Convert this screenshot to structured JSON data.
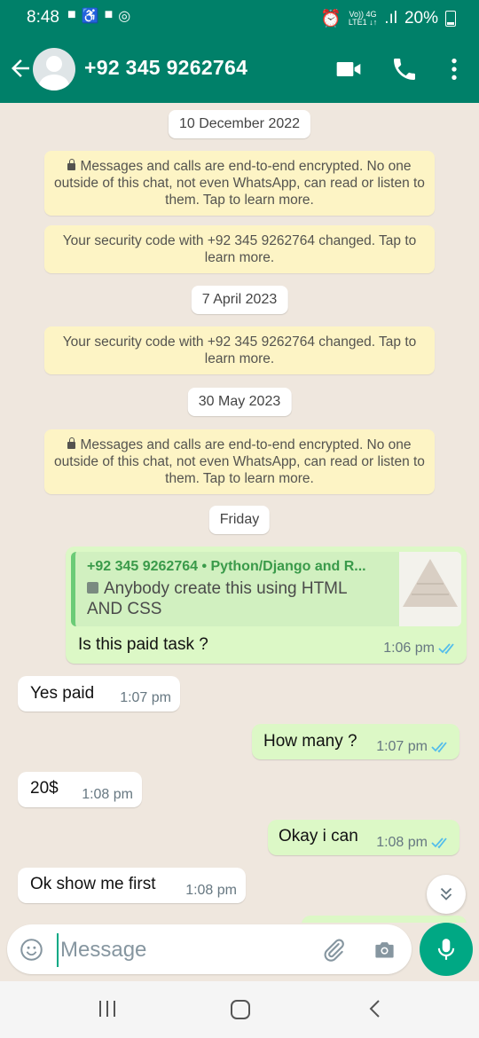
{
  "status_bar": {
    "time": "8:48",
    "network_top": "Vo)) 4G",
    "network_bottom": "LTE1 ↓↑",
    "battery": "20%"
  },
  "header": {
    "contact": "+92 345 9262764",
    "icons": [
      "back-arrow-icon",
      "avatar",
      "video-call-icon",
      "voice-call-icon",
      "more-options-icon"
    ]
  },
  "chat": {
    "date_1": "10 December 2022",
    "encryption_notice_1": "Messages and calls are end-to-end encrypted. No one outside of this chat, not even WhatsApp, can read or listen to them. Tap to learn more.",
    "security_notice_1": "Your security code with +92 345 9262764 changed. Tap to learn more.",
    "date_2": "7 April 2023",
    "security_notice_2": "Your security code with +92 345 9262764 changed. Tap to learn more.",
    "date_3": "30 May 2023",
    "encryption_notice_2": "Messages and calls are end-to-end encrypted. No one outside of this chat, not even WhatsApp, can read or listen to them. Tap to learn more.",
    "date_4": "Friday",
    "messages": [
      {
        "direction": "out",
        "quote_sender": "+92 345 9262764 • Python/Django and R...",
        "quote_text": "Anybody create this using HTML AND CSS",
        "text": "Is this paid task ?",
        "time": "1:06 pm"
      },
      {
        "direction": "in",
        "text": "Yes paid",
        "time": "1:07 pm"
      },
      {
        "direction": "out",
        "text": "How many ?",
        "time": "1:07 pm"
      },
      {
        "direction": "in",
        "text": "20$",
        "time": "1:08 pm"
      },
      {
        "direction": "out",
        "text": "Okay i can",
        "time": "1:08 pm"
      },
      {
        "direction": "in",
        "text": "Ok show me first",
        "time": "1:08 pm"
      }
    ]
  },
  "composer": {
    "placeholder": "Message"
  },
  "colors": {
    "brand": "#008069",
    "accent": "#00a884",
    "outgoing_bubble": "#dcf8c6",
    "system_notice": "#fdf4c5",
    "read_ticks": "#53bdeb"
  }
}
